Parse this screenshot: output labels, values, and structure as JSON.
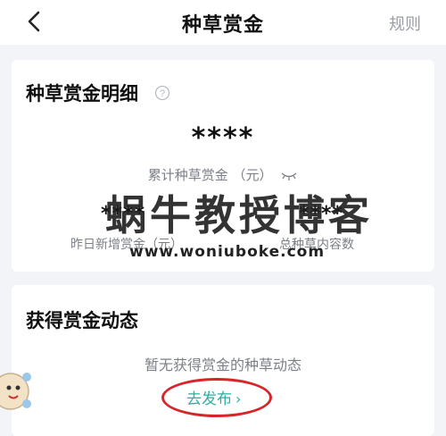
{
  "header": {
    "title": "种草赏金",
    "rules_label": "规则"
  },
  "summary": {
    "title": "种草赏金明细",
    "total_value": "****",
    "total_label": "累计种草赏金 （元）",
    "stats": [
      {
        "value": "****",
        "label": "昨日新增赏金（元）"
      },
      {
        "value": "****",
        "label": "总种草内容数"
      }
    ]
  },
  "activity": {
    "title": "获得赏金动态",
    "empty_text": "暂无获得赏金的种草动态",
    "publish_label": "去发布"
  },
  "watermark": {
    "main": "蜗牛教授博客",
    "url": "www.woniuboke.com"
  },
  "colors": {
    "accent": "#2ab0a3",
    "highlight": "#d9242a",
    "background": "#f3f4f7"
  }
}
